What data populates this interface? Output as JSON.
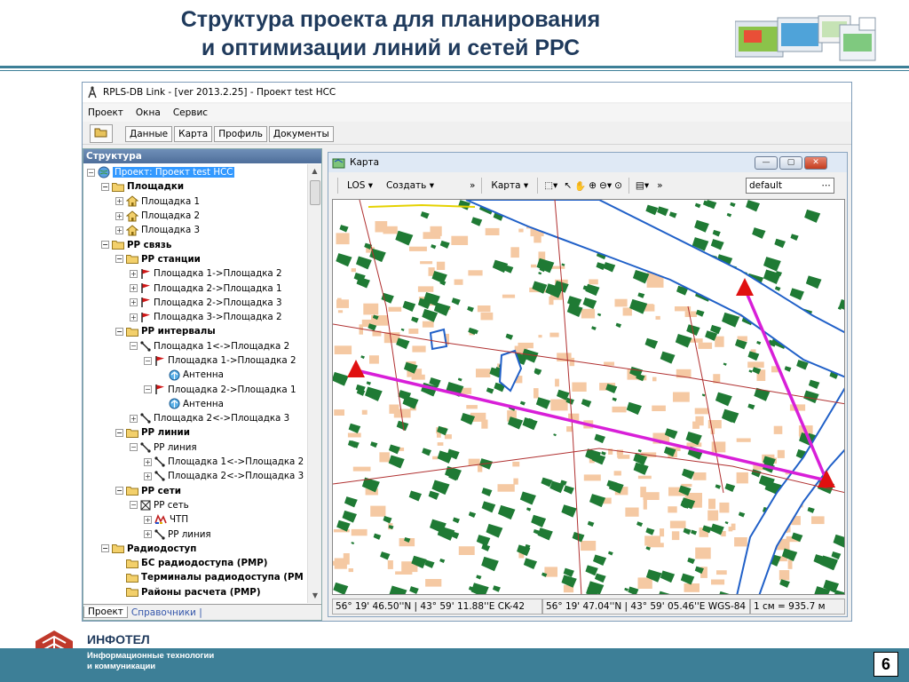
{
  "slide": {
    "title_line1": "Структура проекта для планирования",
    "title_line2": "и оптимизации линий и сетей РРС",
    "page_number": "6"
  },
  "footer": {
    "brand": "ИНФОТЕЛ",
    "tagline_line1": "Информационные технологии",
    "tagline_line2": "и коммуникации"
  },
  "app": {
    "window_title": "RPLS-DB Link -  [ver 2013.2.25] - Проект test HCC",
    "menu": [
      "Проект",
      "Окна",
      "Сервис"
    ],
    "toolbar": [
      "Данные",
      "Карта",
      "Профиль",
      "Документы"
    ]
  },
  "structure_panel": {
    "header": "Структура",
    "tree": [
      {
        "label": "Проект: Проект test HCC",
        "selected": true,
        "icon": "project-globe-icon"
      },
      {
        "label": "Площадки",
        "bold": true,
        "icon": "folder-icon"
      },
      {
        "label": "Площадка 1",
        "icon": "site-house-icon"
      },
      {
        "label": "Площадка 2",
        "icon": "site-house-icon"
      },
      {
        "label": "Площадка 3",
        "icon": "site-house-icon"
      },
      {
        "label": "РР связь",
        "bold": true,
        "icon": "folder-icon"
      },
      {
        "label": "РР станции",
        "bold": true,
        "icon": "folder-icon"
      },
      {
        "label": "Площадка 1->Площадка 2",
        "icon": "station-flag-icon"
      },
      {
        "label": "Площадка 2->Площадка 1",
        "icon": "station-flag-icon"
      },
      {
        "label": "Площадка 2->Площадка 3",
        "icon": "station-flag-icon"
      },
      {
        "label": "Площадка 3->Площадка 2",
        "icon": "station-flag-icon"
      },
      {
        "label": "РР интервалы",
        "bold": true,
        "icon": "folder-icon"
      },
      {
        "label": "Площадка 1<->Площадка 2",
        "icon": "interval-link-icon"
      },
      {
        "label": "Площадка 1->Площадка 2",
        "icon": "station-flag-icon"
      },
      {
        "label": "Антенна",
        "icon": "antenna-icon"
      },
      {
        "label": "Площадка 2->Площадка 1",
        "icon": "station-flag-icon"
      },
      {
        "label": "Антенна",
        "icon": "antenna-icon"
      },
      {
        "label": "Площадка 2<->Площадка 3",
        "icon": "interval-link-icon"
      },
      {
        "label": "РР линии",
        "bold": true,
        "icon": "folder-icon"
      },
      {
        "label": "РР линия",
        "icon": "interval-link-icon"
      },
      {
        "label": "Площадка 1<->Площадка 2",
        "icon": "interval-link-icon"
      },
      {
        "label": "Площадка 2<->Площадка 3",
        "icon": "interval-link-icon"
      },
      {
        "label": "РР сети",
        "bold": true,
        "icon": "folder-icon"
      },
      {
        "label": "РР сеть",
        "icon": "network-box-icon"
      },
      {
        "label": "ЧТП",
        "icon": "frequency-plan-icon"
      },
      {
        "label": "РР линия",
        "icon": "interval-link-icon"
      },
      {
        "label": "Радиодоступ",
        "bold": true,
        "icon": "folder-icon"
      },
      {
        "label": "БС радиодоступа (PMP)",
        "bold": true,
        "icon": "folder-icon"
      },
      {
        "label": "Терминалы радиодоступа (PM",
        "bold": true,
        "icon": "folder-icon"
      },
      {
        "label": "Районы расчета (PMP)",
        "bold": true,
        "icon": "folder-icon"
      }
    ],
    "tabs": [
      "Проект",
      "Справочники |"
    ]
  },
  "map_window": {
    "title": "Карта",
    "toolbar": {
      "los": "LOS",
      "create": "Создать",
      "map": "Карта",
      "layer": "default"
    },
    "status": {
      "coord_ck42": "56° 19' 46.50''N | 43° 59' 11.88''E CK-42",
      "coord_wgs84": "56° 19' 47.04''N | 43° 59' 05.46''E WGS-84",
      "scale": "1 см = 935.7 м"
    },
    "colors": {
      "link": "#d81fd8",
      "site": "#e01010",
      "vegetation": "#1f7a34",
      "buildings": "#f5c9a3",
      "water": "#2060c8"
    }
  }
}
